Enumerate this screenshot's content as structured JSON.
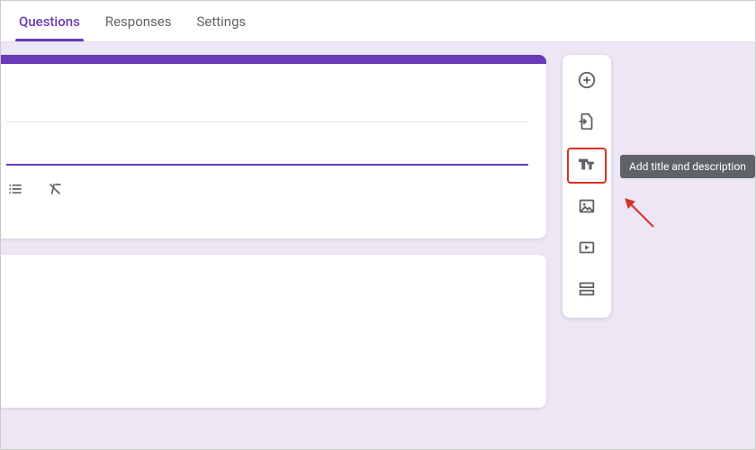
{
  "tabs": {
    "questions": "Questions",
    "responses": "Responses",
    "settings": "Settings"
  },
  "side_toolbar": {
    "add_question": "add-question",
    "import_questions": "import-questions",
    "add_title": "add-title-description",
    "add_image": "add-image",
    "add_video": "add-video",
    "add_section": "add-section"
  },
  "tooltip": {
    "add_title": "Add title and description"
  }
}
